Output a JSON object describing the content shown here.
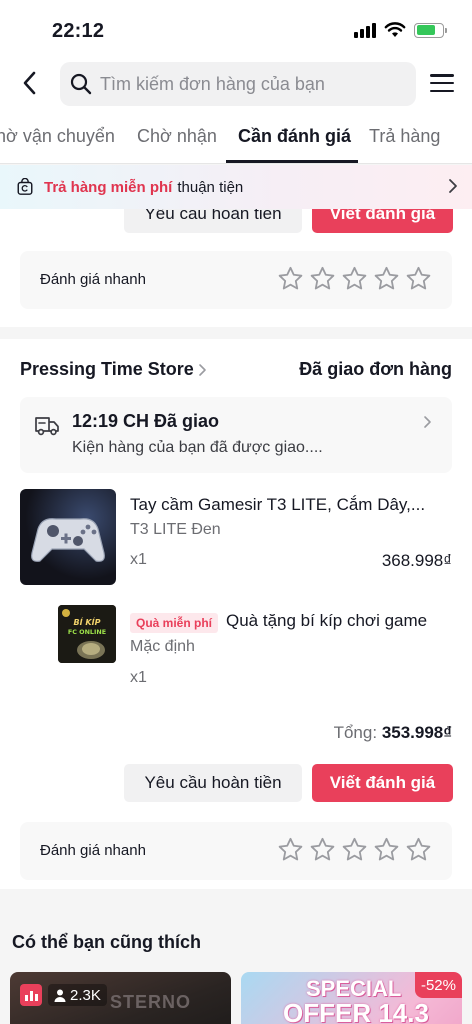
{
  "status_bar": {
    "time": "22:12",
    "battery_level": 0.75
  },
  "header": {
    "search_placeholder": "Tìm kiếm đơn hàng của bạn"
  },
  "tabs": [
    {
      "label": "hờ vận chuyển",
      "active": false
    },
    {
      "label": "Chờ nhận",
      "active": false
    },
    {
      "label": "Cần đánh giá",
      "active": true
    },
    {
      "label": "Trả hàng",
      "active": false
    }
  ],
  "banner": {
    "highlight": "Trả hàng miễn phí",
    "text": "thuận tiện"
  },
  "prev_order": {
    "refund_label": "Yêu cầu hoàn tiền",
    "review_label": "Viết đánh giá",
    "quick_rating_label": "Đánh giá nhanh"
  },
  "order": {
    "store_name": "Pressing Time Store",
    "status": "Đã giao đơn hàng",
    "delivery_time": "12:19 CH Đã giao",
    "delivery_message": "Kiện hàng của bạn đã được giao....",
    "product": {
      "title": "Tay cầm Gamesir T3 LITE, Cắm Dây,...",
      "variant": "T3 LITE Đen",
      "qty": "x1",
      "price": "368.998₫"
    },
    "gift": {
      "badge": "Quà miễn phí",
      "title": "Quà tặng bí kíp chơi game",
      "variant": "Mặc định",
      "qty": "x1",
      "thumb_text_1": "BÍ KÍP",
      "thumb_text_2": "FC ONLINE"
    },
    "total_label": "Tổng:",
    "total_value": "353.998₫",
    "refund_label": "Yêu cầu hoàn tiền",
    "review_label": "Viết đánh giá",
    "quick_rating_label": "Đánh giá nhanh"
  },
  "recommendations": {
    "title": "Có thể bạn cũng thích",
    "cards": [
      {
        "viewers": "2.3K",
        "brand_text": "STERNO"
      },
      {
        "discount": "-52%",
        "promo_line1": "SPECIAL",
        "promo_line2": "OFFER 14.3"
      }
    ]
  },
  "colors": {
    "accent": "#e9405b",
    "text": "#161823",
    "muted": "#6c6d72"
  }
}
